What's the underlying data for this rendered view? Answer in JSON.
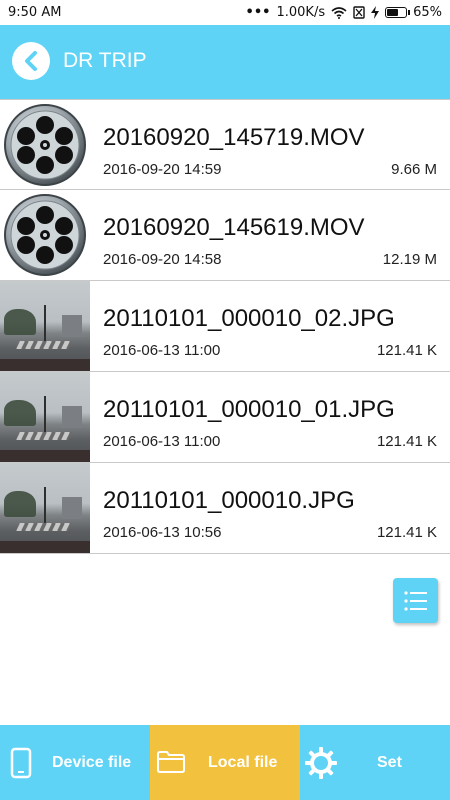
{
  "status_bar": {
    "time": "9:50 AM",
    "network_speed": "1.00K/s",
    "battery_percent": "65%",
    "battery_level": 0.65
  },
  "header": {
    "title": "DR TRIP",
    "back_icon": "chevron-left-icon"
  },
  "files": [
    {
      "name": "20160920_145719.MOV",
      "date": "2016-09-20 14:59",
      "size": "9.66 M",
      "thumb": "film-reel"
    },
    {
      "name": "20160920_145619.MOV",
      "date": "2016-09-20 14:58",
      "size": "12.19 M",
      "thumb": "film-reel"
    },
    {
      "name": "20110101_000010_02.JPG",
      "date": "2016-06-13 11:00",
      "size": "121.41 K",
      "thumb": "photo"
    },
    {
      "name": "20110101_000010_01.JPG",
      "date": "2016-06-13 11:00",
      "size": "121.41 K",
      "thumb": "photo"
    },
    {
      "name": "20110101_000010.JPG",
      "date": "2016-06-13 10:56",
      "size": "121.41 K",
      "thumb": "photo"
    }
  ],
  "fab": {
    "icon": "list-icon"
  },
  "bottom_bar": {
    "tabs": [
      {
        "label": "Device file",
        "icon": "phone-icon"
      },
      {
        "label": "Local file",
        "icon": "folder-icon",
        "active": true
      },
      {
        "label": "Set",
        "icon": "gear-icon"
      }
    ]
  },
  "colors": {
    "accent": "#5ed3f6",
    "active_tab": "#f2c13e"
  }
}
